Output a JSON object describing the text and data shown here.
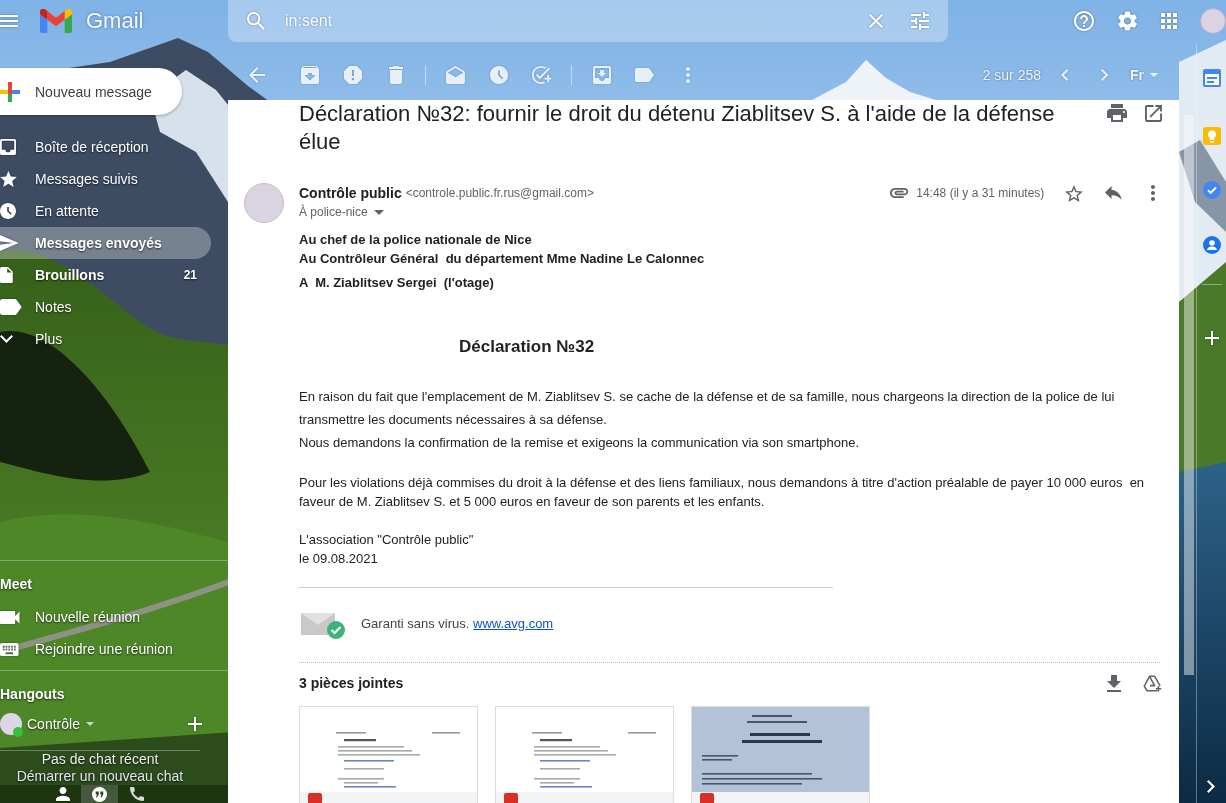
{
  "header": {
    "app_name": "Gmail",
    "search": {
      "value": "in:sent"
    }
  },
  "toolbar": {
    "position": "2 sur 258",
    "input_tool": "Fr"
  },
  "compose": {
    "label": "Nouveau message"
  },
  "sidebar": {
    "items": [
      {
        "label": "Boîte de réception",
        "selected": false
      },
      {
        "label": "Messages suivis",
        "selected": false
      },
      {
        "label": "En attente",
        "selected": false
      },
      {
        "label": "Messages envoyés",
        "selected": true
      },
      {
        "label": "Brouillons",
        "selected": false,
        "count": "21"
      },
      {
        "label": "Notes",
        "selected": false
      },
      {
        "label": "Plus",
        "selected": false
      }
    ]
  },
  "meet": {
    "title": "Meet",
    "items": [
      {
        "label": "Nouvelle réunion"
      },
      {
        "label": "Rejoindre une réunion"
      }
    ]
  },
  "hangouts": {
    "title": "Hangouts",
    "user": {
      "name": "Contrôle",
      "online": true
    },
    "empty_text": "Pas de chat récent",
    "start_link": "Démarrer un nouveau chat",
    "tabs": [
      {
        "selected": false
      },
      {
        "selected": true
      },
      {
        "selected": false
      }
    ]
  },
  "message": {
    "subject": "Déclaration №32: fournir le droit du détenu Ziablitsev S. à l'aide de la défense élue",
    "sender": {
      "name": "Contrôle public",
      "email": "<controle.public.fr.rus@gmail.com>"
    },
    "recipient": "À police-nice",
    "has_attachment": true,
    "time": "14:48 (il y a 31 minutes)",
    "starred": false,
    "body": {
      "addressees": [
        "Au chef de la police nationale de Nice",
        "Au Contrôleur Général  du département Mme Nadine Le Calonnec",
        "A  M. Ziablitsev Sergei  (l'otage)"
      ],
      "heading": "Déclaration №32",
      "paragraphs": [
        [
          "En raison du fait que l'emplacement de M. Ziablitsev S. se cache de la défense et de sa famille, nous chargeons la direction de la police de lui transmettre les documents nécessaires à sa défense.",
          "Nous demandons la confirmation de la remise et exigeons la communication via son smartphone."
        ],
        [
          "Pour les violations déjà commises du droit à la défense et des liens familiaux, nous demandons à titre d'action préalable de payer 10 000 euros  en faveur de M. Ziablitsev S. et 5 000 euros en faveur de son parents et les enfants."
        ],
        [
          "L'association \"Contrôle public\"",
          "le 09.08.2021"
        ]
      ]
    },
    "signature": {
      "text": "Garanti sans virus.",
      "link": "www.avg.com"
    }
  },
  "attachments": {
    "title": "3 pièces jointes",
    "items": [
      {
        "kind": "document"
      },
      {
        "kind": "document"
      },
      {
        "kind": "photo"
      }
    ]
  }
}
